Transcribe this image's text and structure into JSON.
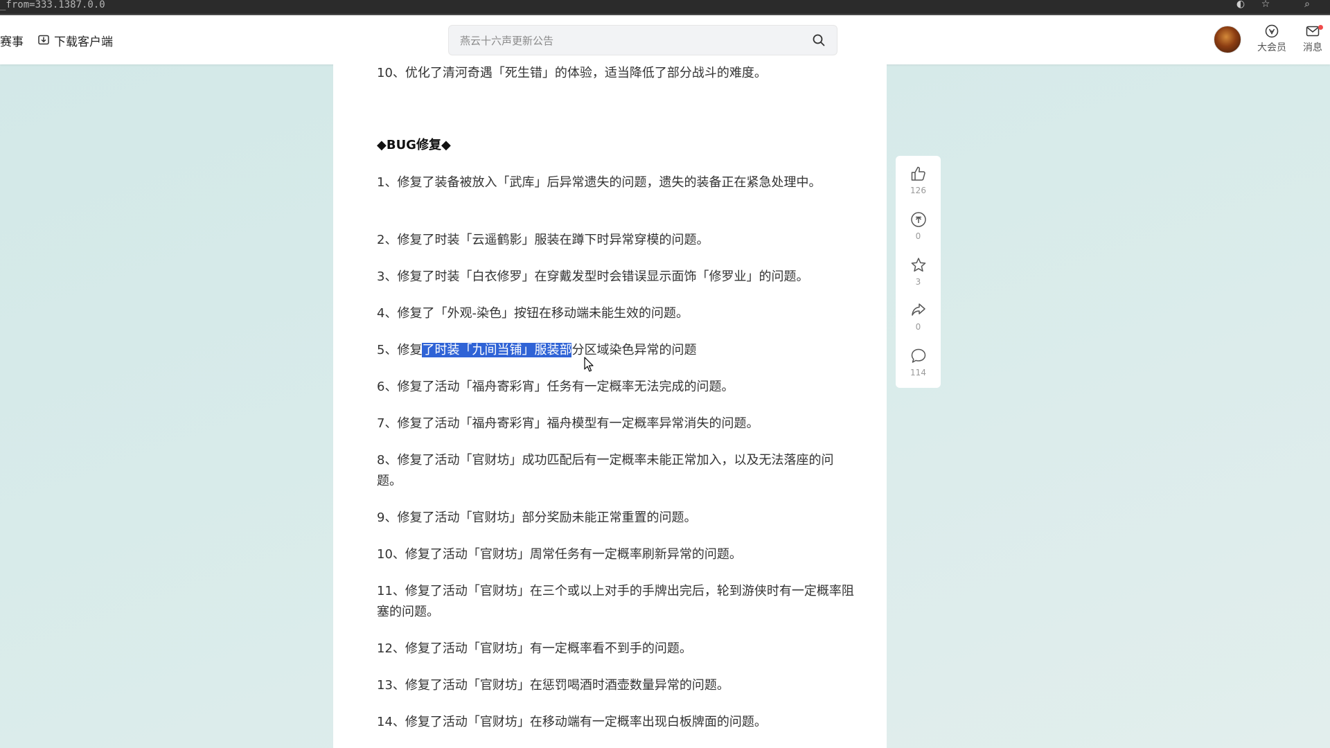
{
  "browser": {
    "url_fragment": "_from=333.1387.0.0",
    "icons": [
      "extension-icon",
      "star-icon",
      "search-icon"
    ]
  },
  "header": {
    "nav_items": [
      {
        "label": "赛事"
      },
      {
        "label": "下载客户端",
        "icon": "download-icon"
      }
    ],
    "search": {
      "placeholder": "燕云十六声更新公告"
    },
    "actions": [
      {
        "label": "大会员",
        "icon": "vip-icon"
      },
      {
        "label": "消息",
        "icon": "message-icon",
        "has_notification": true
      }
    ]
  },
  "article": {
    "top_item": "10、优化了清河奇遇「死生错」的体验，适当降低了部分战斗的难度。",
    "section_title": "◆BUG修复◆",
    "items": [
      "1、修复了装备被放入「武库」后异常遗失的问题，遗失的装备正在紧急处理中。",
      "2、修复了时装「云遥鹤影」服装在蹲下时异常穿模的问题。",
      "3、修复了时装「白衣修罗」在穿戴发型时会错误显示面饰「修罗业」的问题。",
      "4、修复了「外观-染色」按钮在移动端未能生效的问题。",
      "5、修复了时装「九间当铺」服装部分区域染色异常的问题",
      "6、修复了活动「福舟寄彩宵」任务有一定概率无法完成的问题。",
      "7、修复了活动「福舟寄彩宵」福舟模型有一定概率异常消失的问题。",
      "8、修复了活动「官财坊」成功匹配后有一定概率未能正常加入，以及无法落座的问题。",
      "9、修复了活动「官财坊」部分奖励未能正常重置的问题。",
      "10、修复了活动「官财坊」周常任务有一定概率刷新异常的问题。",
      "11、修复了活动「官财坊」在三个或以上对手的手牌出完后，轮到游侠时有一定概率阻塞的问题。",
      "12、修复了活动「官财坊」有一定概率看不到手的问题。",
      "13、修复了活动「官财坊」在惩罚喝酒时酒壶数量异常的问题。",
      "14、修复了活动「官财坊」在移动端有一定概率出现白板牌面的问题。"
    ],
    "selection": {
      "before": "5、修复",
      "selected": "了时装「九间当铺」服装部",
      "after": "分区域染色异常的问题"
    }
  },
  "sidebar": {
    "actions": [
      {
        "name": "like",
        "icon": "thumbs-up-icon",
        "count": "126"
      },
      {
        "name": "coin",
        "icon": "coin-icon",
        "count": "0"
      },
      {
        "name": "favorite",
        "icon": "star-icon",
        "count": "3"
      },
      {
        "name": "share",
        "icon": "share-icon",
        "count": "0"
      },
      {
        "name": "comment",
        "icon": "comment-icon",
        "count": "114"
      }
    ]
  },
  "colors": {
    "page_background": "#d2e8e7",
    "selection": "#2f63d6",
    "notification_dot": "#f04b4b"
  }
}
